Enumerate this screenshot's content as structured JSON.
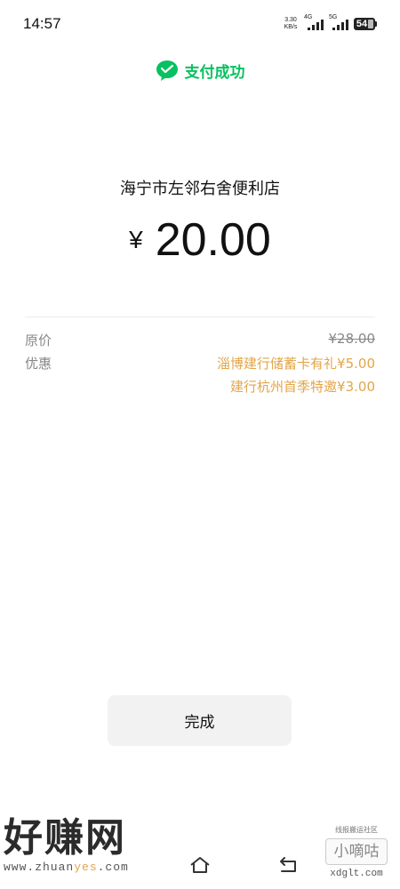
{
  "status_bar": {
    "time": "14:57",
    "net_speed_value": "3.30",
    "net_speed_unit": "KB/s",
    "signal_1_label": "4G",
    "signal_2_label": "5G",
    "battery_level": "54"
  },
  "header": {
    "title": "支付成功",
    "icon": "wechat-pay-icon",
    "accent_color": "#07c160"
  },
  "merchant": {
    "name": "海宁市左邻右舍便利店"
  },
  "amount": {
    "currency": "¥",
    "value": "20.00"
  },
  "details": {
    "original_label": "原价",
    "original_value": "¥28.00",
    "discount_label": "优惠",
    "discounts": [
      "淄博建行储蓄卡有礼¥5.00",
      "建行杭州首季特邀¥3.00"
    ],
    "discount_color": "#e3a548"
  },
  "done_button": {
    "label": "完成"
  },
  "watermarks": {
    "left_big": "好赚网",
    "left_url_prefix": "www.zhuan",
    "left_url_highlight": "yes",
    "left_url_suffix": ".com",
    "right_small": "线报搬运社区",
    "right_box": "小嘀咕",
    "right_url": "xdglt.com"
  },
  "nav": {
    "home_icon": "home-icon",
    "back_icon": "back-icon"
  }
}
